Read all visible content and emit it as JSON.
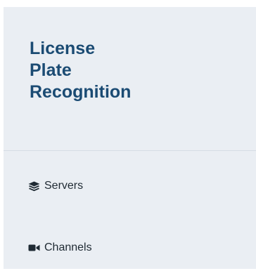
{
  "brand": {
    "line1": "License",
    "line2": "Plate",
    "line3": "Recognition"
  },
  "nav": {
    "items": [
      {
        "label": "Servers",
        "icon": "layers-icon"
      },
      {
        "label": "Channels",
        "icon": "video-camera-icon"
      }
    ]
  },
  "colors": {
    "sidebar_bg": "#eaeef3",
    "brand_text": "#1b4b73",
    "nav_text": "#1f2a33"
  }
}
